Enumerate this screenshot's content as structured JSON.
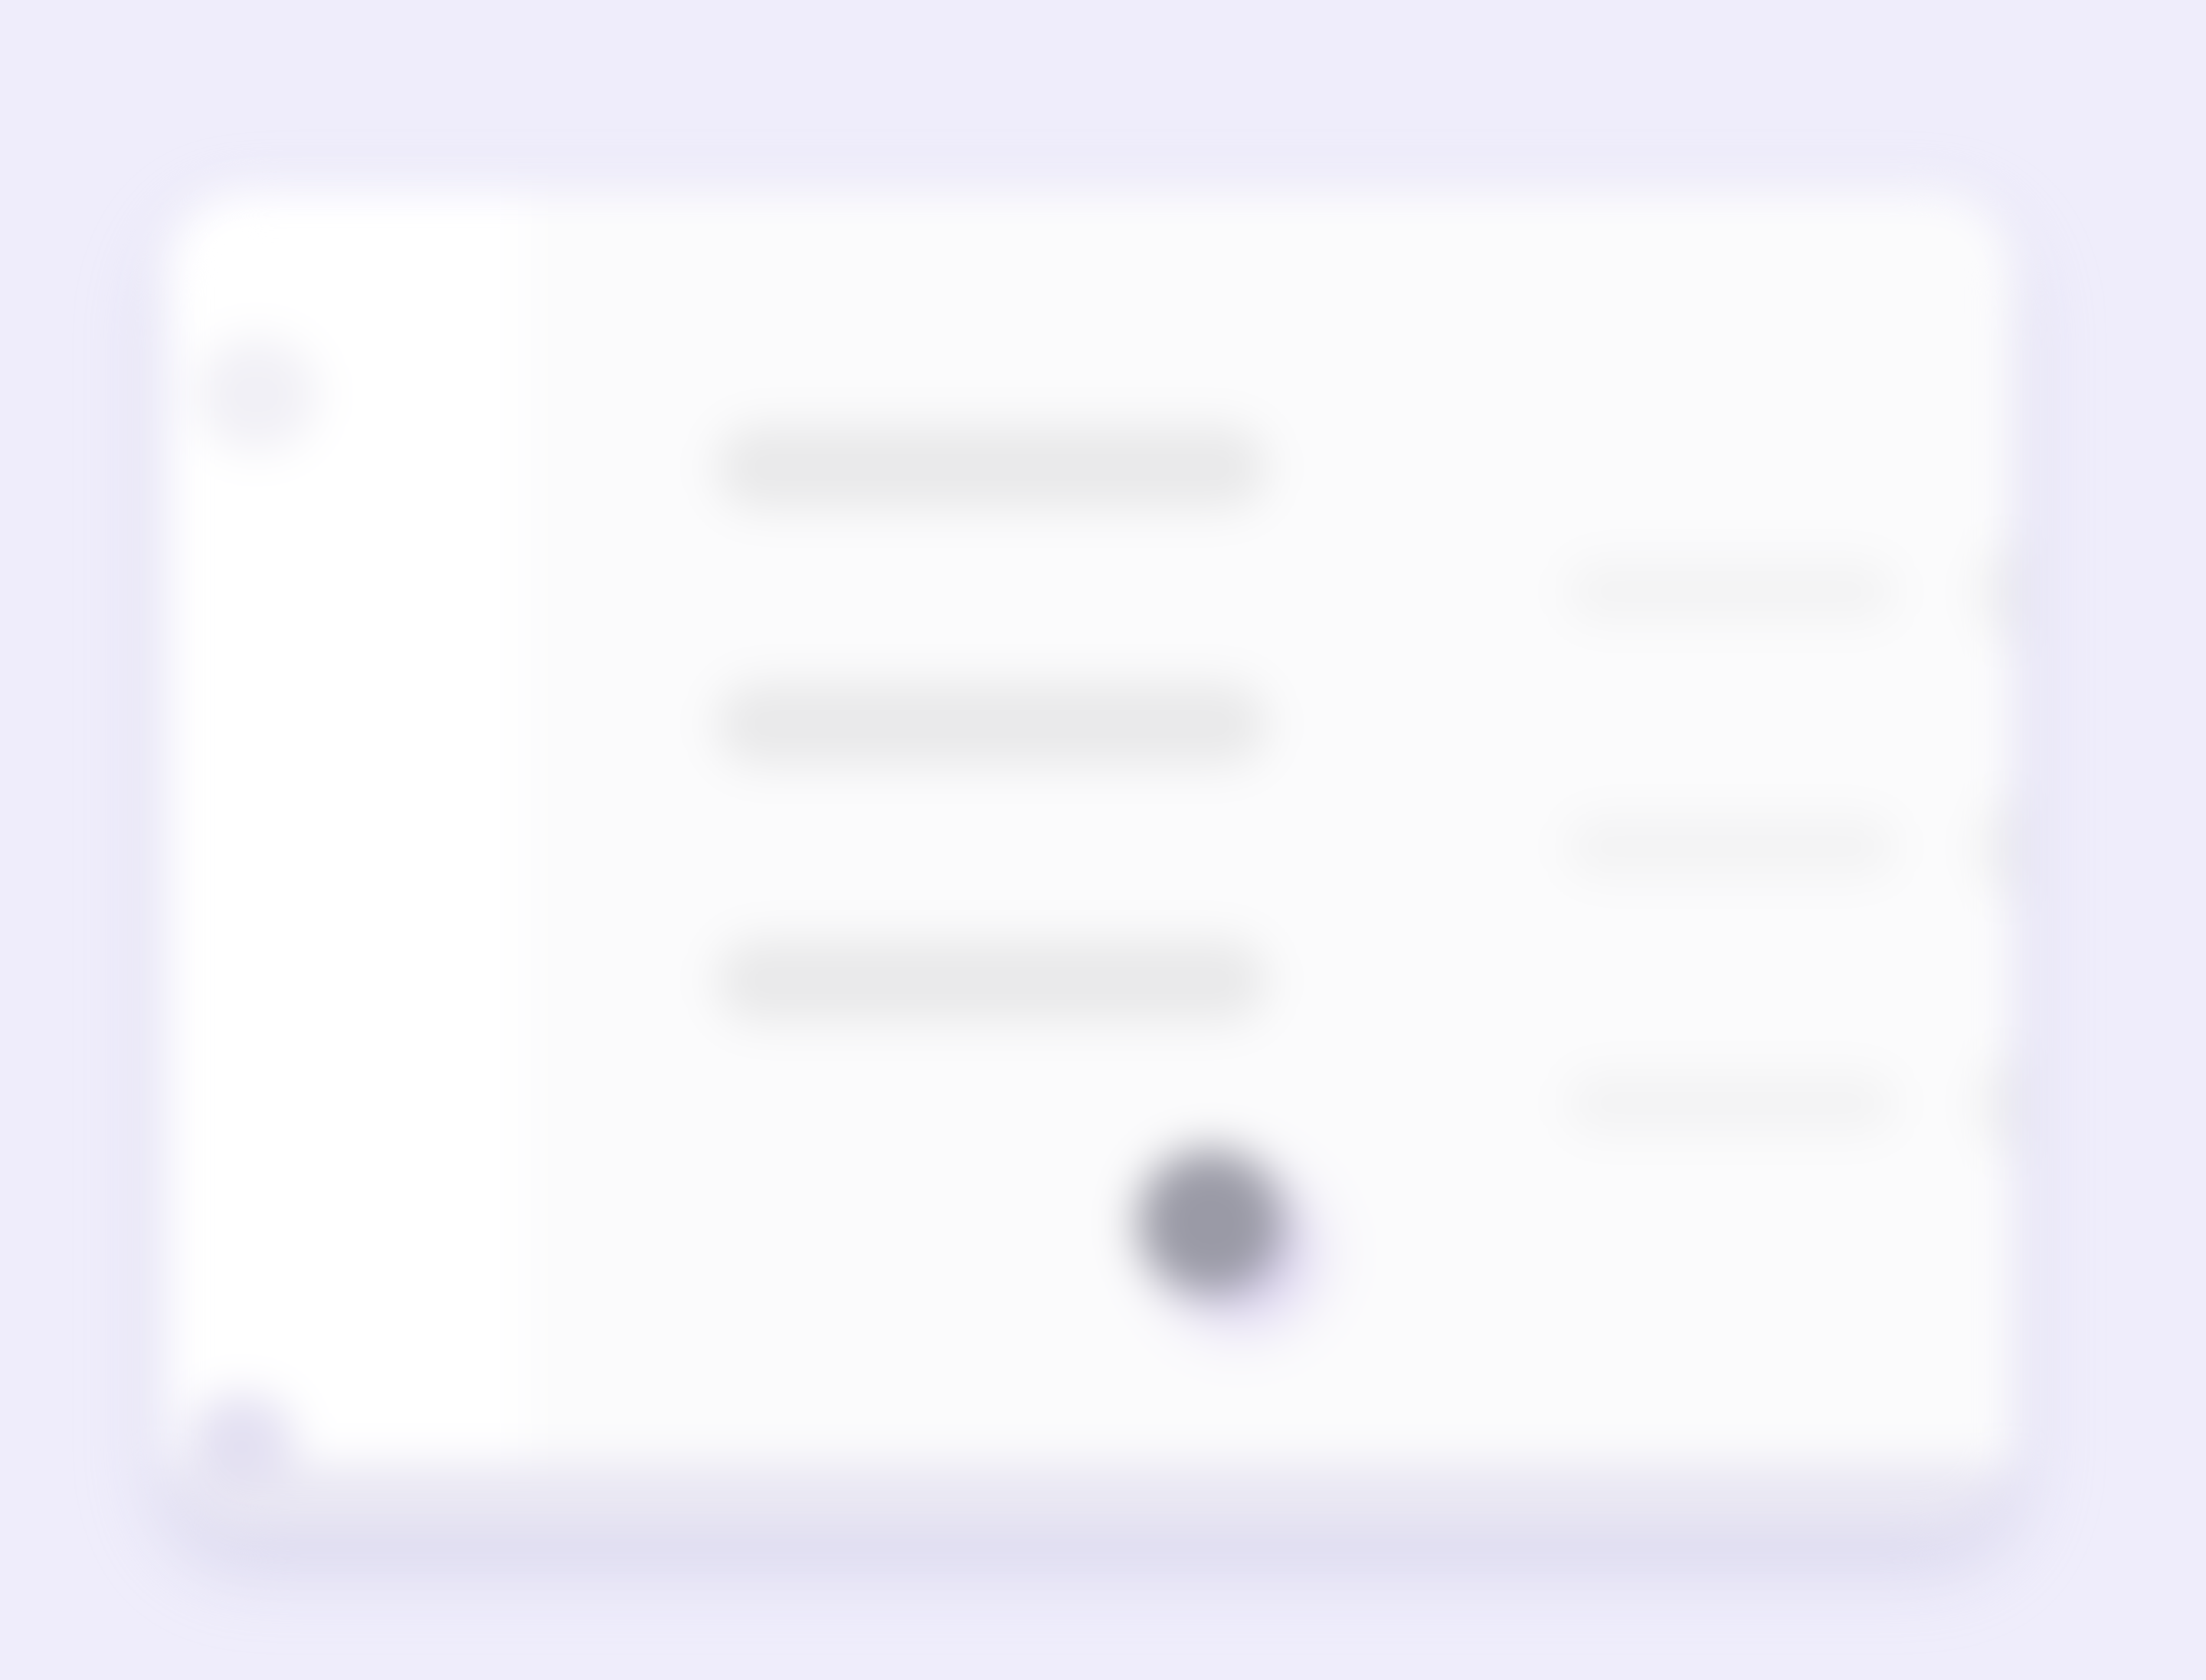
{
  "theme": {
    "background": "#efedfb",
    "window": "#fbfbfc",
    "sidebar": "#ffffff",
    "accent": "#9a9aa6"
  },
  "sidebar": {
    "top_icon": "avatar-icon",
    "bottom_icon": "settings-icon"
  },
  "menu": {
    "items": [
      {
        "label": ""
      },
      {
        "label": ""
      },
      {
        "label": ""
      }
    ]
  },
  "settings": {
    "rows": [
      {
        "label": "",
        "icon": "toggle-icon"
      },
      {
        "label": "",
        "icon": "toggle-icon"
      },
      {
        "label": "",
        "icon": "toggle-icon"
      }
    ]
  },
  "fab": {
    "icon": "circle-action-icon"
  }
}
